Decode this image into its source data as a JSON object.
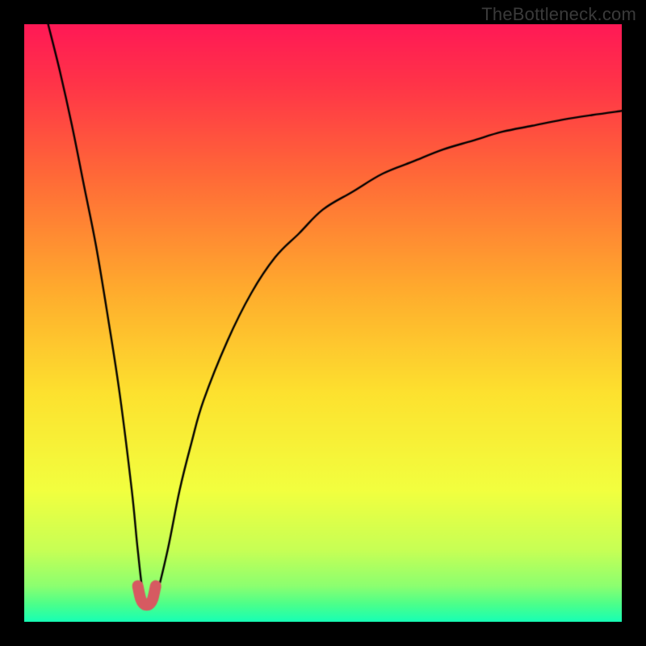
{
  "watermark": "TheBottleneck.com",
  "chart_data": {
    "type": "line",
    "title": "",
    "xlabel": "",
    "ylabel": "",
    "xlim": [
      0,
      100
    ],
    "ylim": [
      0,
      100
    ],
    "grid": false,
    "series": [
      {
        "name": "bottleneck-curve",
        "x": [
          4,
          6,
          8,
          10,
          12,
          14,
          16,
          18,
          19,
          20,
          21,
          22,
          24,
          26,
          28,
          30,
          34,
          38,
          42,
          46,
          50,
          55,
          60,
          65,
          70,
          75,
          80,
          85,
          90,
          95,
          100
        ],
        "values": [
          100,
          92,
          83,
          73,
          63,
          51,
          38,
          22,
          12,
          4,
          3,
          4,
          12,
          22,
          30,
          37,
          47,
          55,
          61,
          65,
          69,
          72,
          75,
          77,
          79,
          80.5,
          82,
          83,
          84,
          84.8,
          85.5
        ]
      },
      {
        "name": "minimum-highlight",
        "x": [
          19,
          19.5,
          20,
          20.5,
          21,
          21.5,
          22
        ],
        "values": [
          6,
          3.8,
          3,
          2.8,
          3,
          3.8,
          6
        ]
      }
    ],
    "gradient_stops": [
      {
        "offset": 0.0,
        "color": "#ff1956"
      },
      {
        "offset": 0.1,
        "color": "#ff3448"
      },
      {
        "offset": 0.25,
        "color": "#ff6838"
      },
      {
        "offset": 0.45,
        "color": "#ffad2d"
      },
      {
        "offset": 0.62,
        "color": "#fde22f"
      },
      {
        "offset": 0.78,
        "color": "#f2ff3f"
      },
      {
        "offset": 0.88,
        "color": "#c7ff55"
      },
      {
        "offset": 0.94,
        "color": "#8cff70"
      },
      {
        "offset": 0.97,
        "color": "#4dff8a"
      },
      {
        "offset": 1.0,
        "color": "#17ffb5"
      }
    ],
    "highlight_color": "#d65a61",
    "curve_color": "#000000"
  }
}
